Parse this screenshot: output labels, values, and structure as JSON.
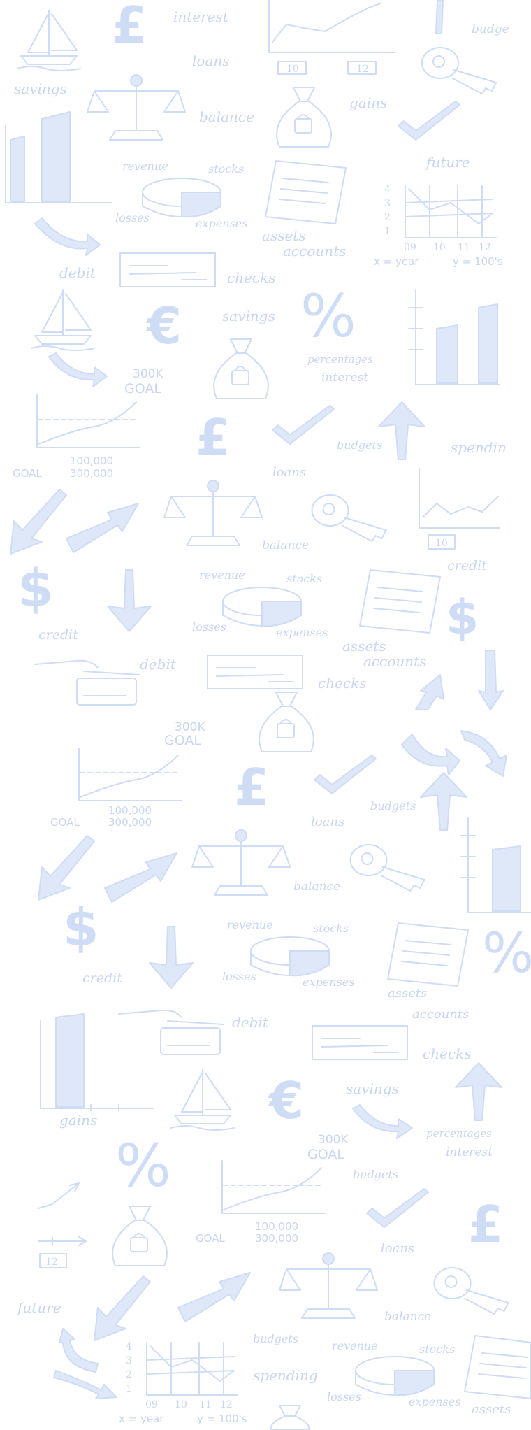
{
  "background": {
    "color": "#ffffff",
    "ink_color": "#cfdcf5"
  },
  "words": {
    "interest": "interest",
    "loans": "loans",
    "budge": "budge",
    "savings": "savings",
    "balance": "balance",
    "gains": "gains",
    "revenue": "revenue",
    "stocks": "stocks",
    "future": "future",
    "losses": "losses",
    "expenses": "expenses",
    "assets": "assets",
    "accounts": "accounts",
    "debit": "debit",
    "checks": "checks",
    "percentages": "percentages",
    "budgets": "budgets",
    "spendin": "spendin",
    "credit": "credit",
    "spending": "spending"
  },
  "glyphs": {
    "pound": "£",
    "euro": "€",
    "dollar": "$",
    "percent": "%"
  },
  "labels": {
    "goal_300k": "300K",
    "goal": "GOAL",
    "goal_legend": "GOAL",
    "amount_100000": "100,000",
    "amount_300000": "300,000",
    "x_year": "x = year",
    "y_100s": "y = 100's",
    "tick_09": "09",
    "tick_10": "10",
    "tick_11": "11",
    "tick_12": "12",
    "tick_4": "4",
    "tick_3": "3",
    "tick_2": "2",
    "tick_1": "1",
    "box_10": "10",
    "box_12": "12"
  }
}
